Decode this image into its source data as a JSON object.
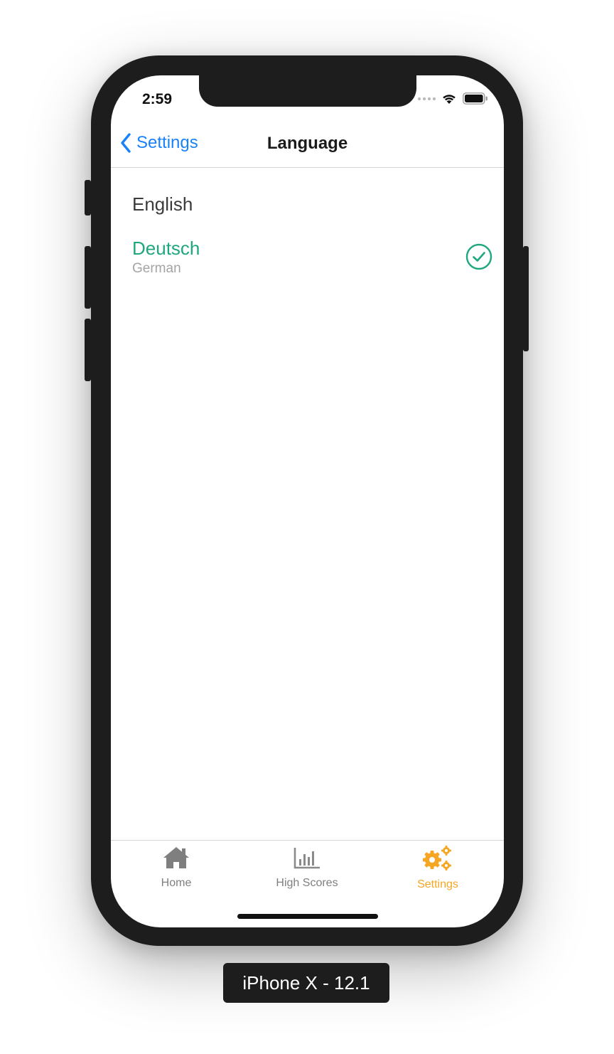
{
  "status_bar": {
    "time": "2:59"
  },
  "nav": {
    "back_label": "Settings",
    "title": "Language"
  },
  "languages": [
    {
      "name": "English",
      "subtitle": "",
      "selected": false
    },
    {
      "name": "Deutsch",
      "subtitle": "German",
      "selected": true
    }
  ],
  "tabs": [
    {
      "label": "Home",
      "icon": "home-icon",
      "active": false
    },
    {
      "label": "High Scores",
      "icon": "bar-chart-icon",
      "active": false
    },
    {
      "label": "Settings",
      "icon": "gears-icon",
      "active": true
    }
  ],
  "device_label": "iPhone X - 12.1",
  "colors": {
    "accent_blue": "#1a82f7",
    "selected_green": "#1fa77f",
    "tab_active": "#f5a623",
    "tab_inactive": "#7f7f7f"
  }
}
